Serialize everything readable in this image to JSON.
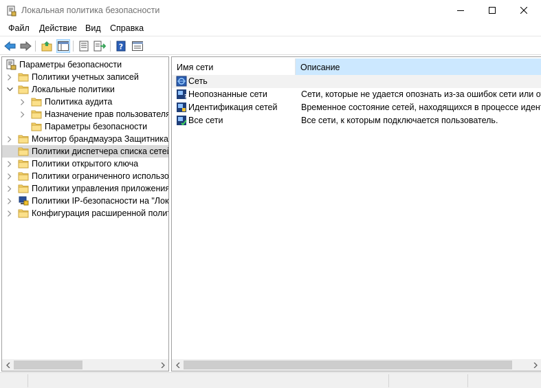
{
  "window": {
    "title": "Локальная политика безопасности",
    "icon": "security-policy-icon"
  },
  "menu": [
    "Файл",
    "Действие",
    "Вид",
    "Справка"
  ],
  "toolbar": {
    "buttons": [
      "back-icon",
      "forward-icon",
      "up-folder-icon",
      "show-hide-tree-icon",
      "properties-icon",
      "export-list-icon",
      "help-icon",
      "view-icon"
    ]
  },
  "tree": {
    "items": [
      {
        "label": "Параметры безопасности",
        "icon": "security-settings-icon",
        "expander": "none",
        "level": 0
      },
      {
        "label": "Политики учетных записей",
        "icon": "folder-icon",
        "expander": "collapsed",
        "level": 1
      },
      {
        "label": "Локальные политики",
        "icon": "folder-icon",
        "expander": "expanded",
        "level": 1
      },
      {
        "label": "Политика аудита",
        "icon": "folder-icon",
        "expander": "collapsed",
        "level": 2
      },
      {
        "label": "Назначение прав пользователя",
        "icon": "folder-icon",
        "expander": "collapsed",
        "level": 2
      },
      {
        "label": "Параметры безопасности",
        "icon": "folder-icon",
        "expander": "none",
        "level": 2
      },
      {
        "label": "Монитор брандмауэра Защитника Windows",
        "icon": "folder-icon",
        "expander": "collapsed",
        "level": 1
      },
      {
        "label": "Политики диспетчера списка сетей",
        "icon": "folder-icon",
        "expander": "none",
        "level": 1,
        "selected": true
      },
      {
        "label": "Политики открытого ключа",
        "icon": "folder-icon",
        "expander": "collapsed",
        "level": 1
      },
      {
        "label": "Политики ограниченного использования программ",
        "icon": "folder-icon",
        "expander": "collapsed",
        "level": 1
      },
      {
        "label": "Политики управления приложениями",
        "icon": "folder-icon",
        "expander": "collapsed",
        "level": 1
      },
      {
        "label": "Политики IP-безопасности на \"Локальный компьютер\"",
        "icon": "ipsec-icon",
        "expander": "collapsed",
        "level": 1
      },
      {
        "label": "Конфигурация расширенной политики аудита",
        "icon": "folder-icon",
        "expander": "collapsed",
        "level": 1
      }
    ]
  },
  "list": {
    "columns": [
      "Имя сети",
      "Описание"
    ],
    "group": "Сеть",
    "rows": [
      {
        "name": "Неопознанные сети",
        "description": "Сети, которые не удается опознать из-за ошибок сети или отсутствия идентифицируемых характеристик.",
        "icon": "unidentified-network-icon"
      },
      {
        "name": "Идентификация сетей",
        "description": "Временное состояние сетей, находящихся в процессе идентификации.",
        "icon": "identifying-network-icon"
      },
      {
        "name": "Все сети",
        "description": "Все сети, к которым подключается пользователь.",
        "icon": "all-networks-icon"
      }
    ]
  },
  "colors": {
    "selection": "#d9d9d9",
    "header_highlight": "#cce8ff",
    "folder": "#f6d36b"
  }
}
